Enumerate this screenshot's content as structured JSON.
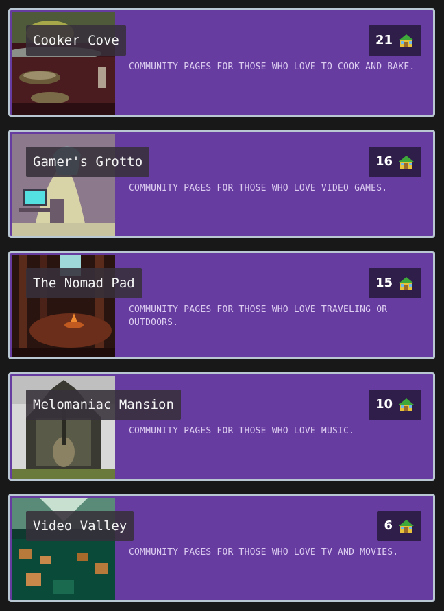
{
  "communities": [
    {
      "title": "Cooker Cove",
      "count": "21",
      "description": "COMMUNITY PAGES FOR THOSE WHO LOVE TO COOK AND BAKE.",
      "image_icon": "cooking-scene-icon"
    },
    {
      "title": "Gamer's Grotto",
      "count": "16",
      "description": "COMMUNITY PAGES FOR THOSE WHO LOVE VIDEO GAMES.",
      "image_icon": "gaming-cave-icon"
    },
    {
      "title": "The Nomad Pad",
      "count": "15",
      "description": "COMMUNITY PAGES FOR THOSE WHO LOVE TRAVELING OR OUTDOORS.",
      "image_icon": "campfire-forest-icon"
    },
    {
      "title": "Melomaniac Mansion",
      "count": "10",
      "description": "COMMUNITY PAGES FOR THOSE WHO LOVE MUSIC.",
      "image_icon": "guitar-mansion-icon"
    },
    {
      "title": "Video Valley",
      "count": "6",
      "description": "COMMUNITY PAGES FOR THOSE WHO LOVE TV AND MOVIES.",
      "image_icon": "tv-valley-icon"
    }
  ],
  "badge_icon": "house-icon",
  "colors": {
    "card_bg": "#673ca1",
    "card_border": "#b9c7d3",
    "badge_bg": "#2f1e4a",
    "page_bg": "#181818"
  }
}
